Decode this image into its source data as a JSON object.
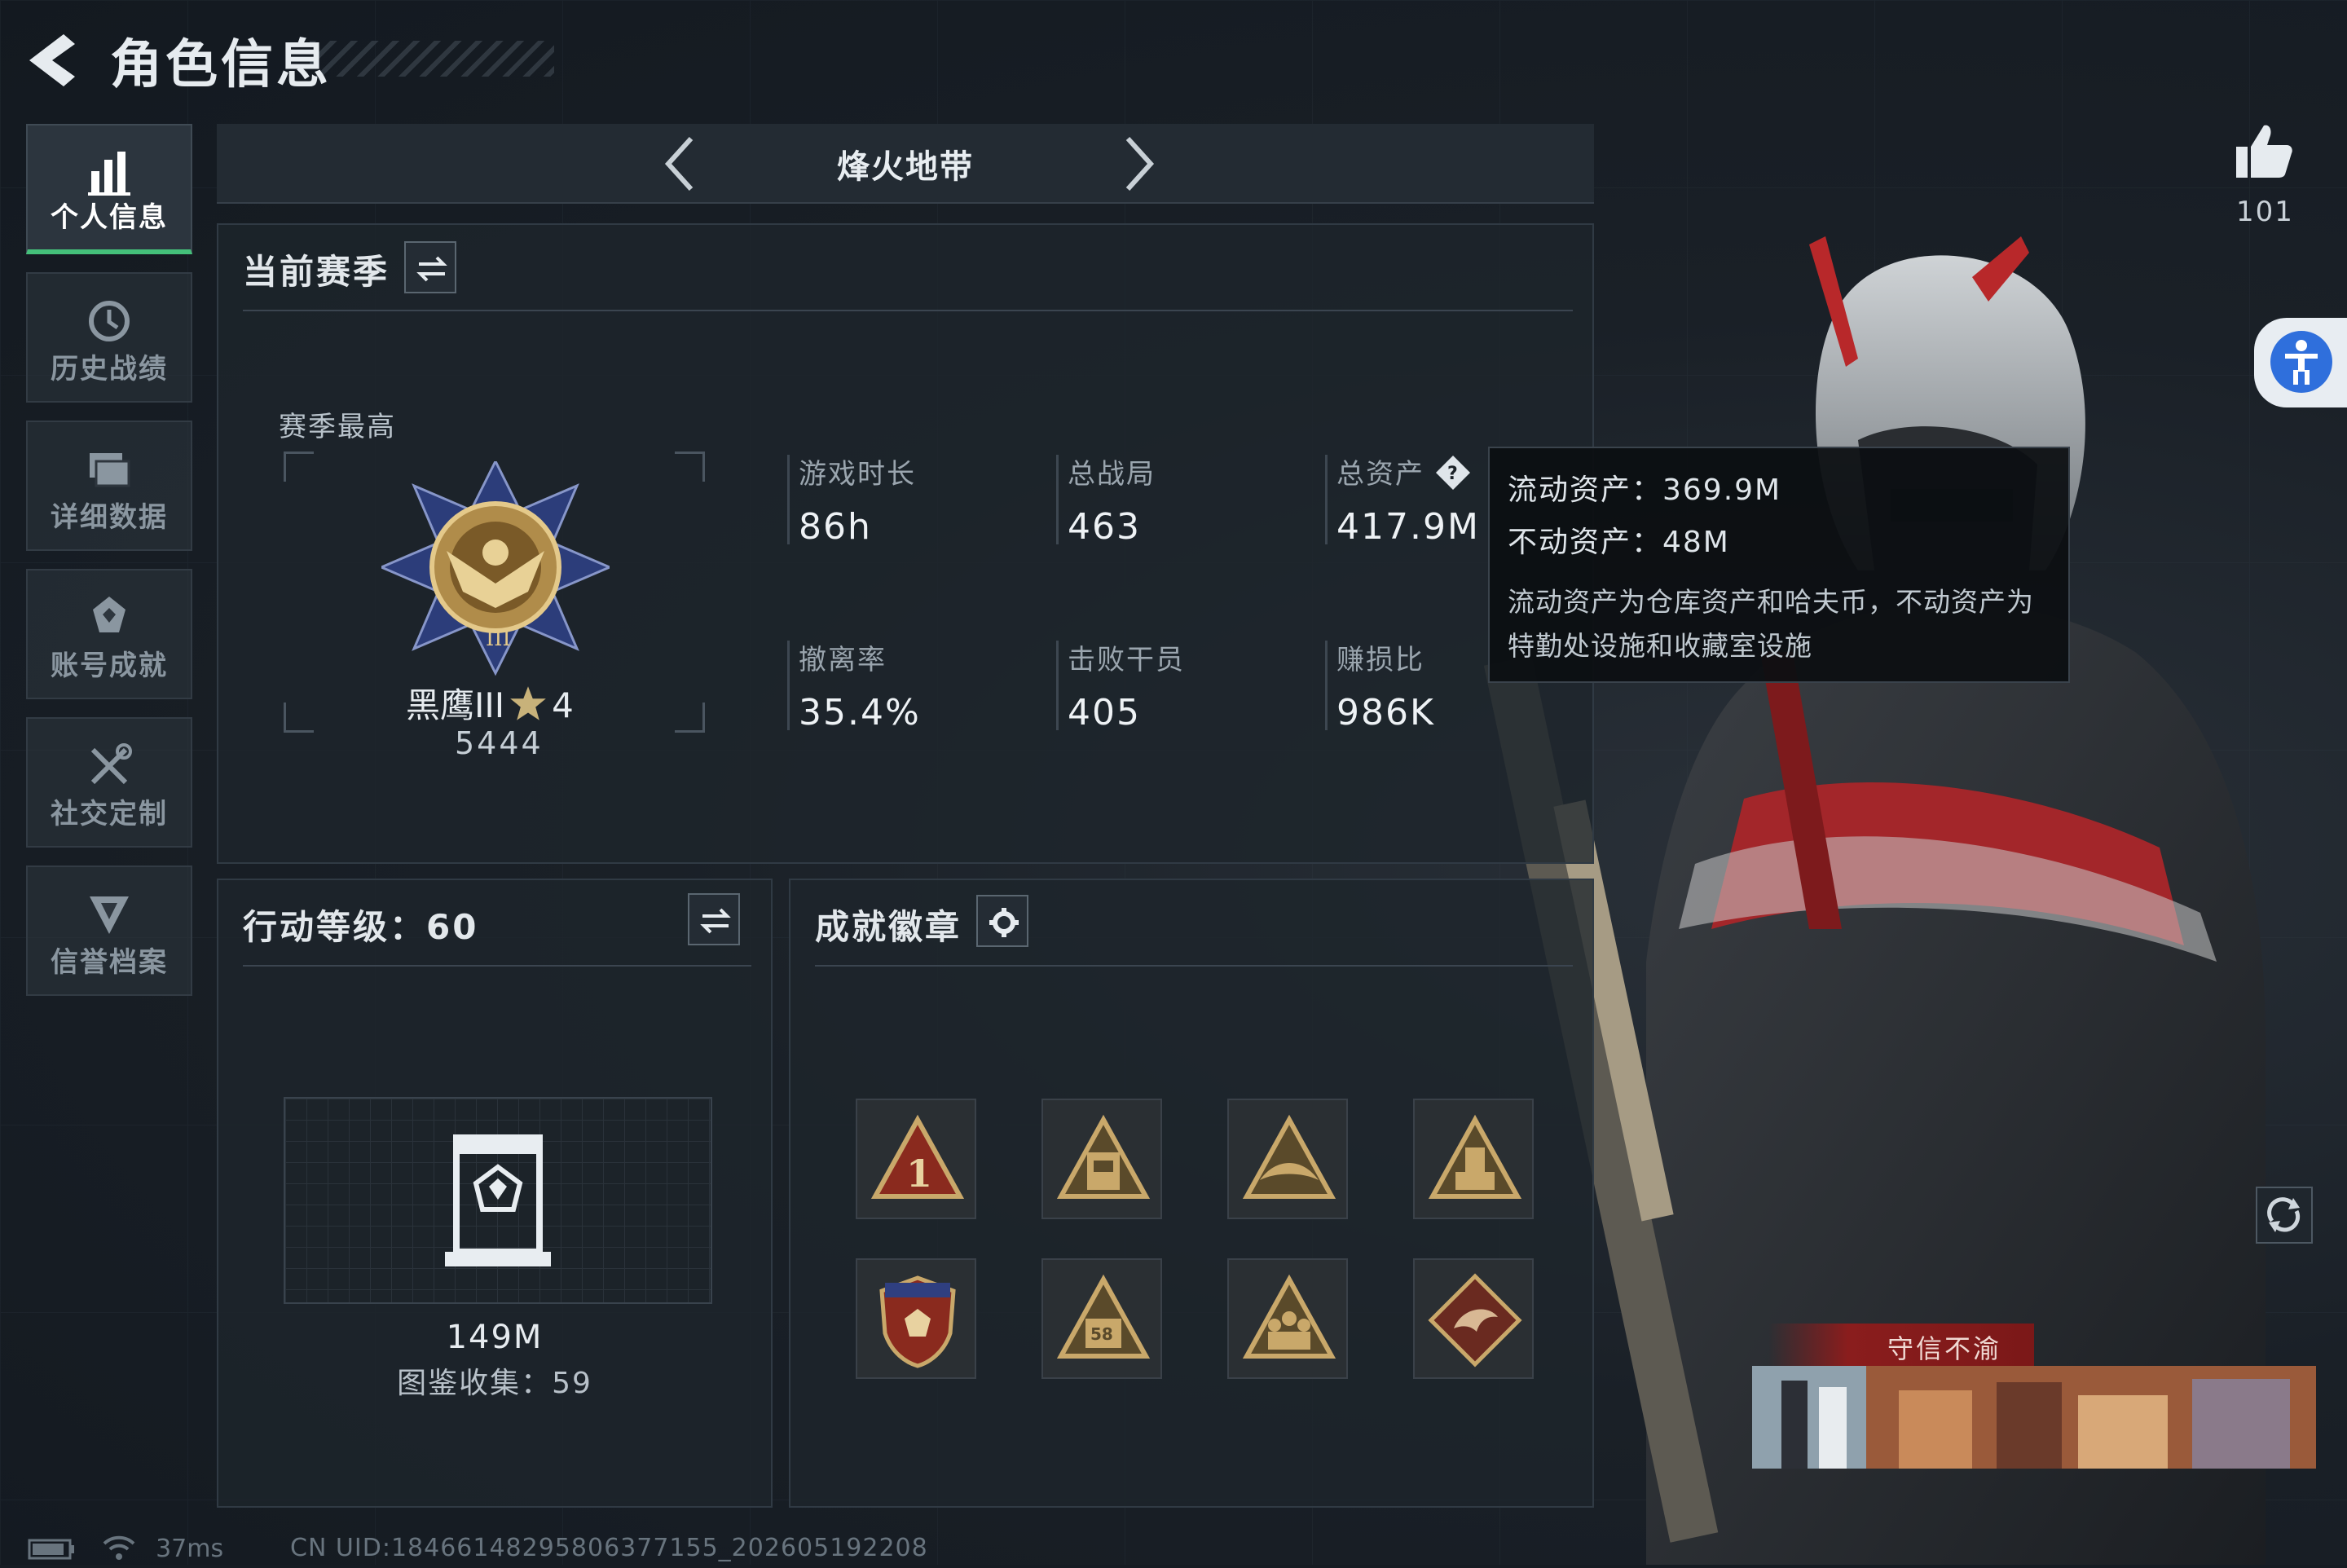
{
  "header": {
    "title": "角色信息"
  },
  "sidebar": {
    "items": [
      {
        "label": "个人信息",
        "active": true
      },
      {
        "label": "历史战绩"
      },
      {
        "label": "详细数据"
      },
      {
        "label": "账号成就"
      },
      {
        "label": "社交定制"
      },
      {
        "label": "信誉档案"
      }
    ]
  },
  "map_selector": {
    "name": "烽火地带"
  },
  "season": {
    "heading": "当前赛季",
    "best_label": "赛季最高",
    "rank_name": "黑鹰III",
    "rank_stars": "4",
    "rank_score": "5444",
    "stats": [
      {
        "label": "游戏时长",
        "value": "86h"
      },
      {
        "label": "总战局",
        "value": "463"
      },
      {
        "label": "总资产",
        "value": "417.9M"
      },
      {
        "label": "撤离率",
        "value": "35.4%"
      },
      {
        "label": "击败干员",
        "value": "405"
      },
      {
        "label": "赚损比",
        "value": "986K"
      }
    ]
  },
  "tooltip": {
    "liquid": "流动资产：369.9M",
    "fixed": "不动资产：48M",
    "note": "流动资产为仓库资产和哈夫币，不动资产为特勤处设施和收藏室设施"
  },
  "level": {
    "heading": "行动等级：60",
    "asset_value": "149M",
    "collection": "图鉴收集：59"
  },
  "badges": {
    "heading": "成就徽章"
  },
  "profile": {
    "likes": "101",
    "title_plate": "守信不渝"
  },
  "status_bar": {
    "ping": "37ms",
    "uid": "CN UID:18466148295806377155_202605192208"
  },
  "colors": {
    "accent_green": "#44c07a",
    "badge_gold": "#c9a86a",
    "badge_red": "#8a2a1e",
    "access_blue": "#2f6fdc"
  }
}
